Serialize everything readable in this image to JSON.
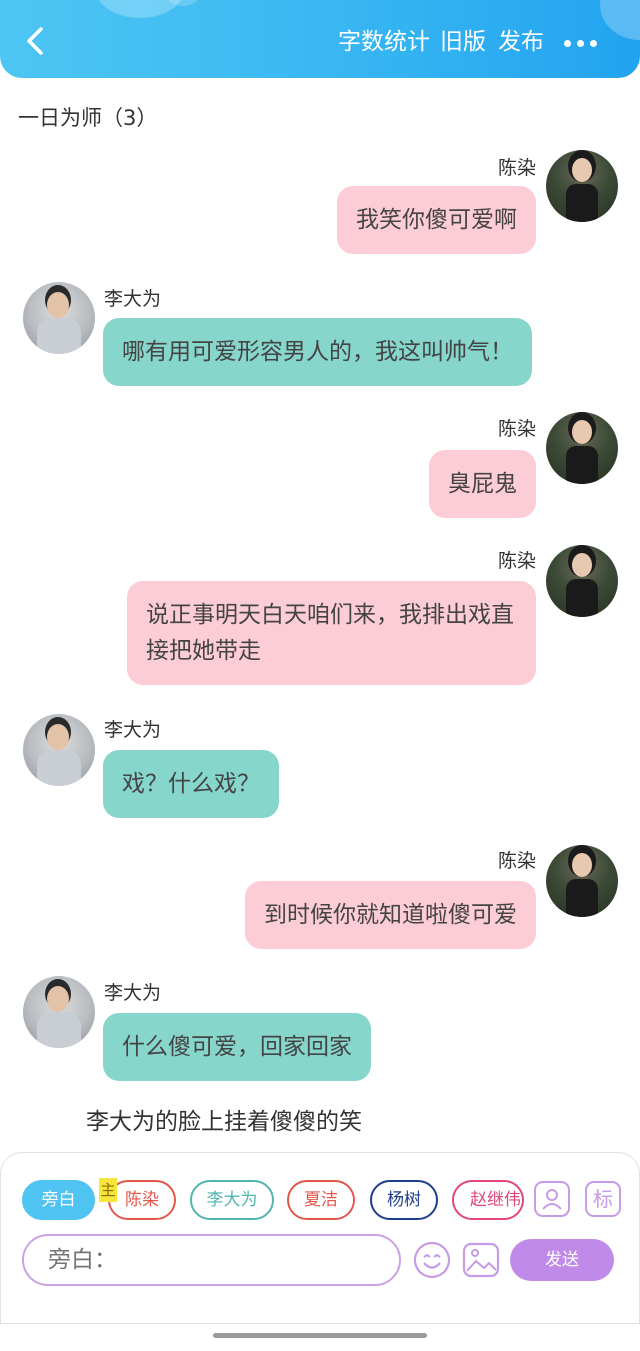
{
  "header": {
    "back_icon": "chevron-left-icon",
    "actions": [
      "字数统计",
      "旧版",
      "发布"
    ],
    "more_icon": "more-dots-icon",
    "gradient": [
      "#4ec6f3",
      "#22a3f0"
    ]
  },
  "chapter": {
    "title": "一日为师（3）"
  },
  "messages": [
    {
      "speaker": "陈染",
      "side": "right",
      "text_lines": [
        "我笑你傻可爱啊"
      ]
    },
    {
      "speaker": "李大为",
      "side": "left",
      "text_lines": [
        "哪有用可爱形容男人的，我这叫帅气！"
      ]
    },
    {
      "speaker": "陈染",
      "side": "right",
      "text_lines": [
        "臭屁鬼"
      ]
    },
    {
      "speaker": "陈染",
      "side": "right",
      "text_lines": [
        "说正事明天白天咱们来，我排出戏直",
        "接把她带走"
      ]
    },
    {
      "speaker": "李大为",
      "side": "left",
      "text_lines": [
        "戏？什么戏？"
      ]
    },
    {
      "speaker": "陈染",
      "side": "right",
      "text_lines": [
        "到时候你就知道啦傻可爱"
      ]
    },
    {
      "speaker": "李大为",
      "side": "left",
      "text_lines": [
        "什么傻可爱，回家回家"
      ]
    }
  ],
  "narration": "李大为的脸上挂着傻傻的笑",
  "bubble_colors": {
    "right": "#fccdd6",
    "left": "#86d6cb"
  },
  "composer": {
    "characters": [
      {
        "label": "旁白",
        "color": "#4fc3f1",
        "active": true
      },
      {
        "label": "陈染",
        "color": "#e2574c",
        "main_tag": "主"
      },
      {
        "label": "李大为",
        "color": "#52b6b0"
      },
      {
        "label": "夏洁",
        "color": "#e2574c"
      },
      {
        "label": "杨树",
        "color": "#1f3f8a"
      },
      {
        "label": "赵继伟",
        "color": "#e0487a"
      }
    ],
    "role_icon": "person-card-icon",
    "tag_label": "标",
    "input_placeholder": "旁白：",
    "emoji_icon": "emoji-icon",
    "image_icon": "image-icon",
    "send_label": "发送",
    "accent": "#c08be8"
  }
}
